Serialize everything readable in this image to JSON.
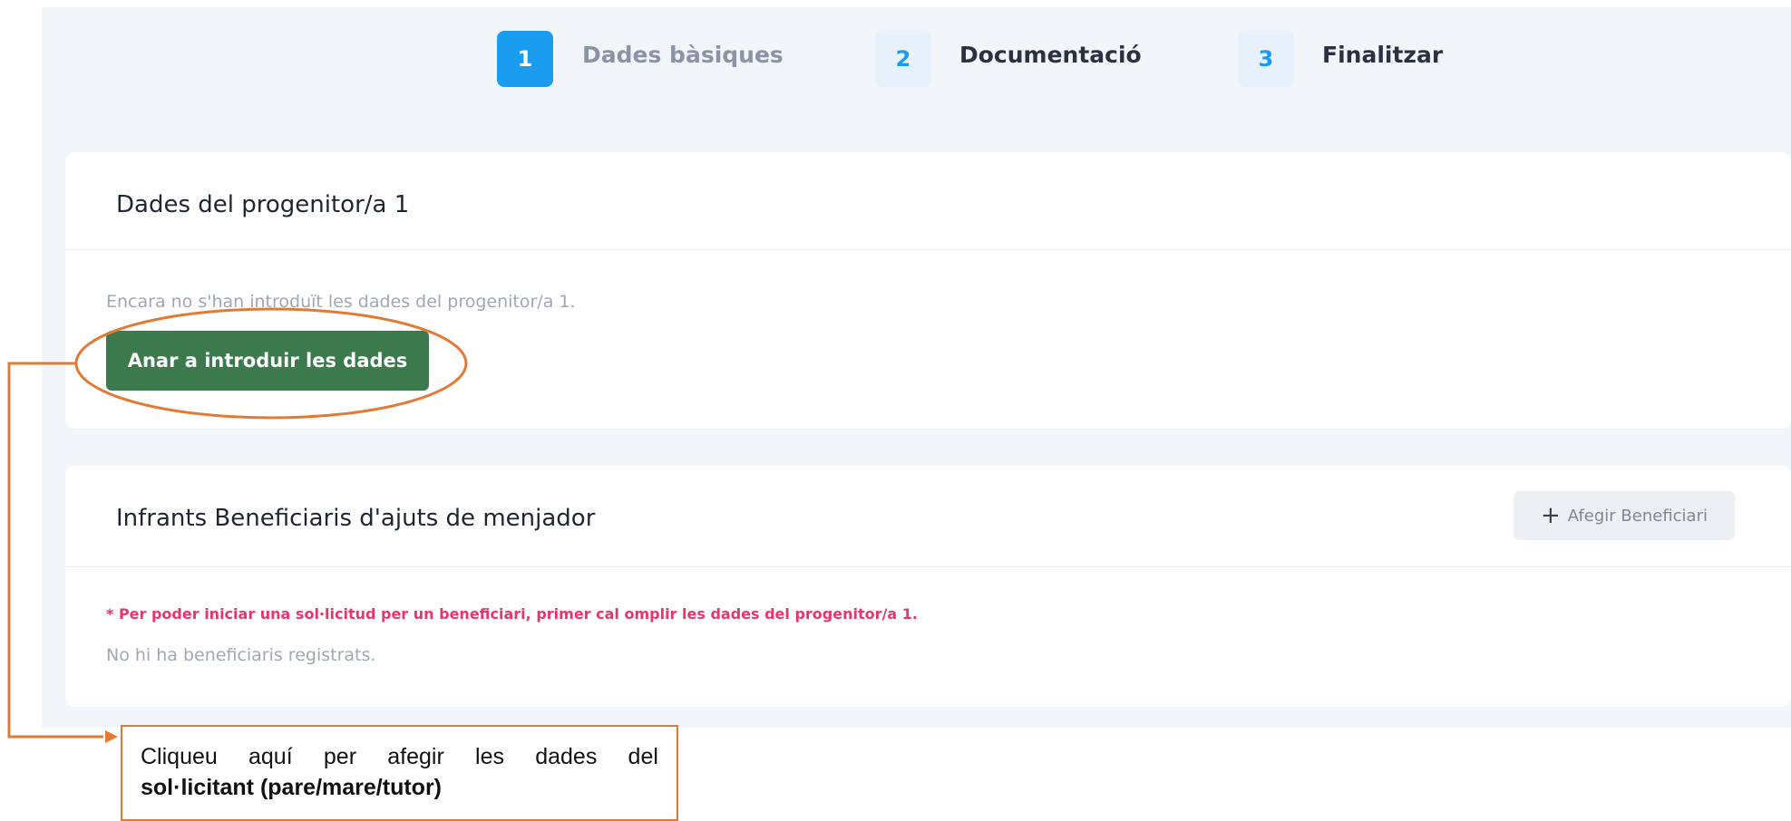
{
  "stepper": {
    "steps": [
      {
        "number": "1",
        "label": "Dades bàsiques"
      },
      {
        "number": "2",
        "label": "Documentació"
      },
      {
        "number": "3",
        "label": "Finalitzar"
      }
    ]
  },
  "parent_card": {
    "title": "Dades del progenitor/a 1",
    "empty_text": "Encara no s'han introduït les dades del progenitor/a 1.",
    "button_label": "Anar a introduir les dades"
  },
  "beneficiaries_card": {
    "title": "Infrants Beneficiaris d'ajuts de menjador",
    "add_button_label": "Afegir Beneficiari",
    "warning": "* Per poder iniciar una sol·licitud per un beneficiari, primer cal omplir les dades del progenitor/a 1.",
    "empty_text": "No hi ha beneficiaris registrats."
  },
  "annotation": {
    "line1_words": [
      "Cliqueu",
      "aquí",
      "per",
      "afegir",
      "les",
      "dades",
      "del"
    ],
    "line2_bold": "sol·licitant (pare/mare/tutor)"
  },
  "colors": {
    "accent_blue": "#1a9cf0",
    "primary_green": "#3c7a4d",
    "warning_pink": "#e8356b",
    "annotation_orange": "#e07a35"
  },
  "icons": {
    "add_beneficiary": "plus-icon"
  }
}
